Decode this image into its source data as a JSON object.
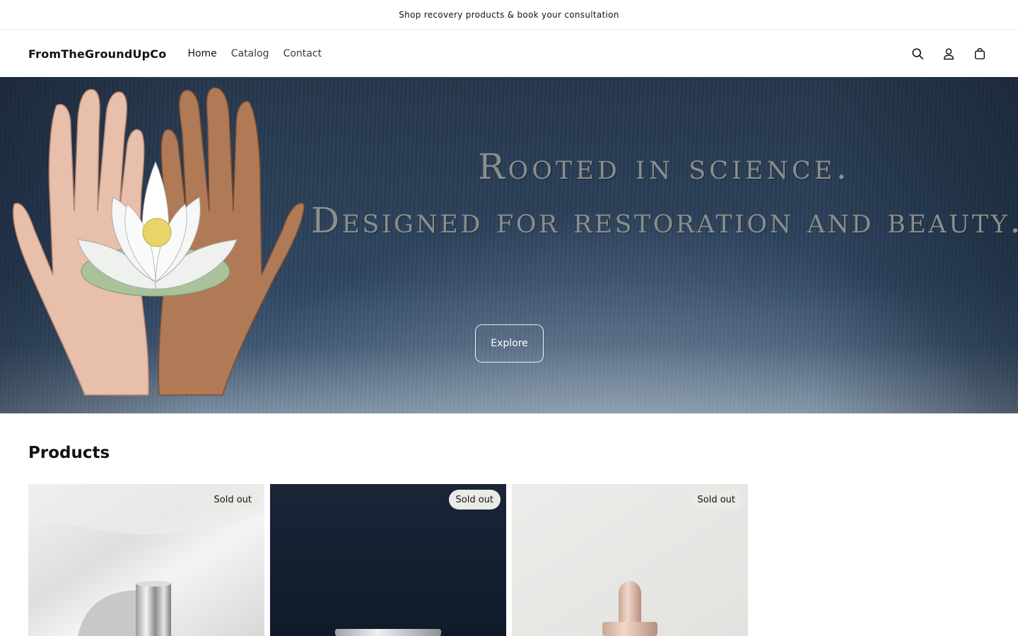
{
  "announcement": {
    "text": "Shop recovery products & book your consultation"
  },
  "header": {
    "logo": "FromTheGroundUpCo",
    "nav": [
      {
        "label": "Home"
      },
      {
        "label": "Catalog"
      },
      {
        "label": "Contact"
      }
    ],
    "icons": [
      "search-icon",
      "account-icon",
      "cart-icon"
    ]
  },
  "hero": {
    "line1": "Rooted in science.",
    "line2": "Designed for restoration and beauty.",
    "button": "Explore"
  },
  "products": {
    "title": "Products",
    "items": [
      {
        "badge": "Sold out",
        "image": "silver-serum-bottle-on-white-silk"
      },
      {
        "badge": "Sold out",
        "image": "white-jar-on-navy-background"
      },
      {
        "badge": "Sold out",
        "image": "rose-gold-dropper-bottle-on-light-gray"
      }
    ]
  },
  "colors": {
    "hero_bg": "#2a3f57",
    "text": "#121212",
    "badge_bg": "#eaeae6",
    "hero_text": "#8b8e8d"
  }
}
